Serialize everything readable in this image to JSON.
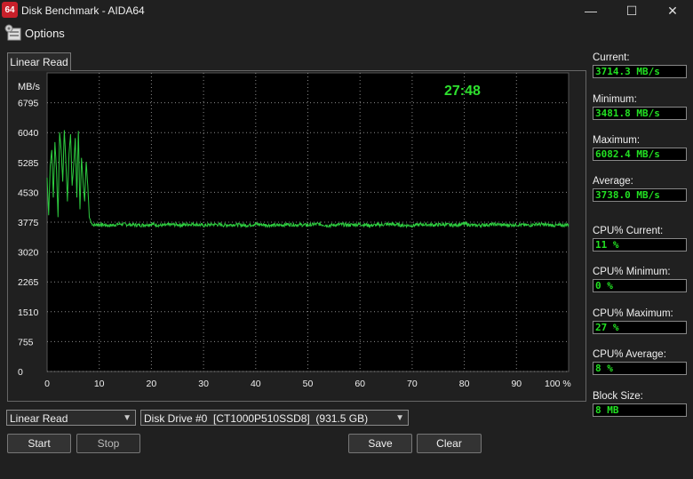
{
  "window": {
    "app_icon_text": "64",
    "title": "Disk Benchmark - AIDA64",
    "controls": {
      "minimize": "—",
      "maximize": "☐",
      "close": "✕"
    }
  },
  "menu": {
    "options_label": "Options",
    "options_icon": "options-icon"
  },
  "tab": {
    "label": "Linear Read"
  },
  "chart_data": {
    "type": "line",
    "ylabel": "MB/s",
    "ytick_labels": [
      "0",
      "755",
      "1510",
      "2265",
      "3020",
      "3775",
      "4530",
      "5285",
      "6040",
      "6795"
    ],
    "yticks": [
      0,
      755,
      1510,
      2265,
      3020,
      3775,
      4530,
      5285,
      6040,
      6795
    ],
    "ylim": [
      0,
      7550
    ],
    "xtick_labels": [
      "0",
      "10",
      "20",
      "30",
      "40",
      "50",
      "60",
      "70",
      "80",
      "90",
      "100 %"
    ],
    "xticks": [
      0,
      10,
      20,
      30,
      40,
      50,
      60,
      70,
      80,
      90,
      100
    ],
    "xlim": [
      0,
      100
    ],
    "grid": true,
    "timer": "27:48",
    "line_color": "#2ecc40",
    "series": [
      {
        "x": [
          0,
          0.3,
          0.6,
          0.9,
          1.2,
          1.5,
          1.8,
          2.1,
          2.4,
          2.7,
          3.0,
          3.3,
          3.6,
          3.9,
          4.2,
          4.5,
          4.8,
          5.1,
          5.4,
          5.7,
          6.0,
          6.3,
          6.6,
          6.9,
          7.2,
          7.5,
          7.8,
          8.1,
          8.5,
          9,
          10,
          12,
          14,
          16,
          18,
          20,
          22,
          24,
          26,
          28,
          30,
          32,
          34,
          36,
          38,
          40,
          42,
          44,
          46,
          48,
          50,
          52,
          54,
          56,
          58,
          60,
          62,
          64,
          66,
          68,
          70,
          72,
          74,
          76,
          78,
          80,
          82,
          84,
          86,
          88,
          90,
          92,
          94,
          96,
          98,
          100
        ],
        "y": [
          4900,
          3950,
          5200,
          5600,
          4400,
          5800,
          5100,
          3900,
          6050,
          5600,
          4800,
          6100,
          5300,
          4300,
          5500,
          6000,
          4700,
          5200,
          5900,
          4400,
          6080,
          4100,
          5400,
          4800,
          4300,
          5300,
          4700,
          3900,
          3750,
          3700,
          3720,
          3690,
          3730,
          3710,
          3700,
          3725,
          3690,
          3715,
          3705,
          3730,
          3690,
          3720,
          3700,
          3715,
          3695,
          3725,
          3705,
          3690,
          3720,
          3710,
          3700,
          3730,
          3690,
          3715,
          3705,
          3720,
          3695,
          3710,
          3725,
          3700,
          3690,
          3720,
          3705,
          3715,
          3700,
          3730,
          3690,
          3710,
          3720,
          3700,
          3715,
          3695,
          3725,
          3705,
          3690,
          3714
        ]
      }
    ]
  },
  "stats": [
    {
      "label": "Current:",
      "value": "3714.3 MB/s"
    },
    {
      "label": "Minimum:",
      "value": "3481.8 MB/s"
    },
    {
      "label": "Maximum:",
      "value": "6082.4 MB/s"
    },
    {
      "label": "Average:",
      "value": "3738.0 MB/s"
    },
    {
      "label": "CPU% Current:",
      "value": "11 %"
    },
    {
      "label": "CPU% Minimum:",
      "value": "0 %"
    },
    {
      "label": "CPU% Maximum:",
      "value": "27 %"
    },
    {
      "label": "CPU% Average:",
      "value": "8 %"
    },
    {
      "label": "Block Size:",
      "value": "8 MB"
    }
  ],
  "controls": {
    "mode_select": "Linear Read",
    "drive_select": "Disk Drive #0  [CT1000P510SSD8]  (931.5 GB)",
    "start": "Start",
    "stop": "Stop",
    "save": "Save",
    "clear": "Clear"
  }
}
